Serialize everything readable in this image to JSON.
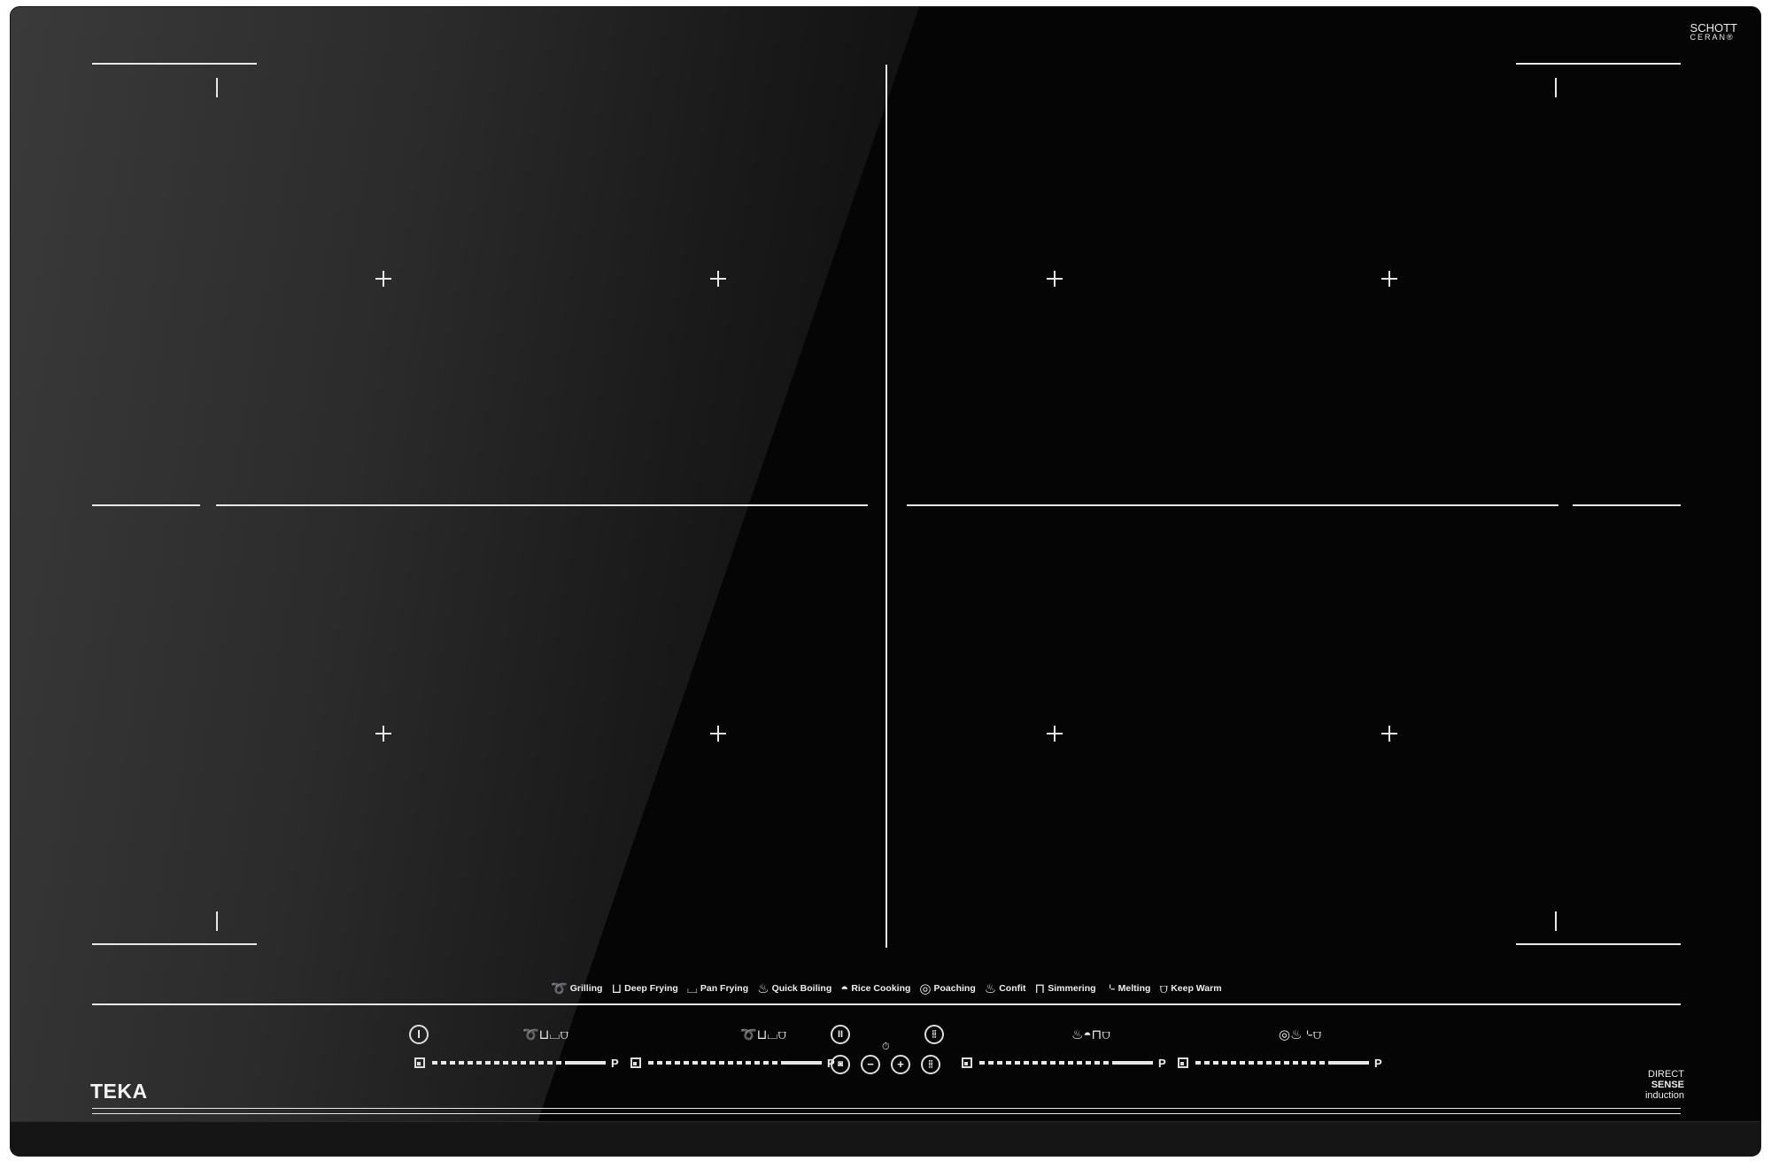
{
  "brand": {
    "name": "TEKA",
    "logo_text": "TEKA"
  },
  "glass": {
    "line1": "SCHOTT",
    "line2": "CERAN®"
  },
  "badge": {
    "line1": "DIRECT",
    "line2": "SENSE",
    "line3": "induction"
  },
  "functions": [
    {
      "icon": "grill-icon",
      "label": "Grilling"
    },
    {
      "icon": "deep-fry-icon",
      "label": "Deep Frying"
    },
    {
      "icon": "pan-icon",
      "label": "Pan Frying"
    },
    {
      "icon": "boil-icon",
      "label": "Quick Boiling"
    },
    {
      "icon": "rice-icon",
      "label": "Rice Cooking"
    },
    {
      "icon": "poach-icon",
      "label": "Poaching"
    },
    {
      "icon": "confit-icon",
      "label": "Confit"
    },
    {
      "icon": "pot-icon",
      "label": "Simmering"
    },
    {
      "icon": "melt-icon",
      "label": "Melting"
    },
    {
      "icon": "warm-icon",
      "label": "Keep Warm"
    }
  ],
  "controls": {
    "power_symbol": "I",
    "pause_symbol": "II",
    "minus_symbol": "−",
    "plus_symbol": "+",
    "lock_symbol": "⊞",
    "timer_symbol": "⏱",
    "slider_end_label": "P"
  },
  "colors": {
    "glass": "#050505",
    "markings": "#e8e8e8"
  }
}
